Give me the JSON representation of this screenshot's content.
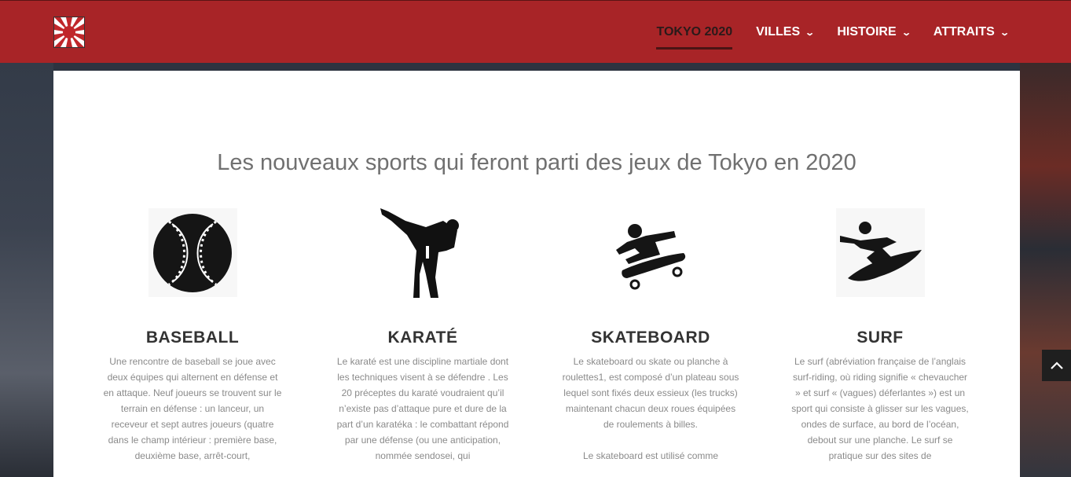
{
  "header": {
    "logo_icon": "rising-sun-flag-icon",
    "nav": [
      {
        "label": "TOKYO 2020",
        "active": true
      },
      {
        "label": "VILLES",
        "dropdown": true
      },
      {
        "label": "HISTOIRE",
        "dropdown": true
      },
      {
        "label": "ATTRAITS",
        "dropdown": true
      }
    ]
  },
  "main": {
    "headline": "Les nouveaux sports qui feront parti des jeux de Tokyo en 2020",
    "sports": [
      {
        "icon": "baseball-icon",
        "title": "BASEBALL",
        "paragraphs": [
          "Une rencontre de baseball se joue avec deux équipes qui alternent en défense et en attaque. Neuf joueurs se trouvent sur le terrain en défense : un lanceur, un receveur et sept autres joueurs (quatre dans le champ intérieur : première base, deuxième base, arrêt-court,"
        ]
      },
      {
        "icon": "karate-icon",
        "title": "KARATÉ",
        "paragraphs": [
          "Le karaté est une discipline martiale dont les techniques visent à se défendre . Les 20 préceptes du karaté voudraient qu’il n’existe pas d’attaque pure et dure de la part d’un karatéka : le combattant répond par une défense (ou une anticipation, nommée sendosei, qui"
        ]
      },
      {
        "icon": "skateboard-icon",
        "title": "SKATEBOARD",
        "paragraphs": [
          "Le skateboard ou skate ou planche à roulettes1, est composé d’un plateau sous lequel sont fixés deux essieux (les trucks) maintenant chacun deux roues équipées de roulements à billes.",
          "Le skateboard est utilisé comme"
        ]
      },
      {
        "icon": "surf-icon",
        "title": "SURF",
        "paragraphs": [
          "Le surf (abréviation française de l’anglais surf-riding, où riding signifie « chevaucher » et surf « (vagues) déferlantes ») est un sport qui consiste à glisser sur les vagues, ondes de surface, au bord de l’océan, debout sur une planche. Le surf se pratique sur des sites de"
        ]
      }
    ]
  },
  "scroll_top_icon": "chevron-up-icon",
  "colors": {
    "header": "#a82427",
    "active_nav": "#2a1a1a"
  }
}
